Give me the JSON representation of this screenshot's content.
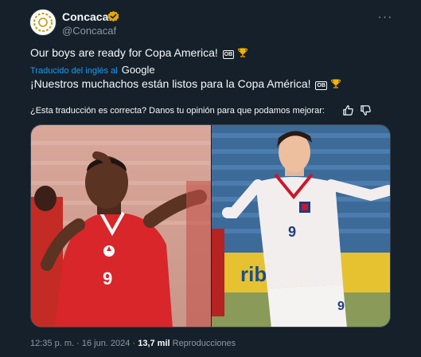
{
  "author": {
    "name": "Concacaf",
    "handle": "@Concacaf",
    "verified_color": "#e8a700"
  },
  "post": {
    "text": "Our boys are ready for Copa America!",
    "badge": "OB",
    "trophy_icon": "trophy-icon"
  },
  "translation": {
    "label": "Traducido del inglés al",
    "provider": "Google",
    "text": "¡Nuestros muchachos están listos para la Copa América!",
    "badge": "OB",
    "feedback": "¿Esta traducción es correcta? Danos tu opinión para que podamos mejorar:"
  },
  "media": {
    "left_photo": "canada-player-number-9",
    "right_photo": "costa-rica-player-number-9",
    "left_jersey_number": "9",
    "right_jersey_number": "9",
    "right_board_text": "rib"
  },
  "meta": {
    "time": "12:35 p. m.",
    "date": "16 jun. 2024",
    "views": "13,7 mil",
    "views_label": "Reproducciones",
    "separator": "·"
  },
  "colors": {
    "background": "#15202b",
    "accent": "#1d9bf0",
    "muted": "#8b98a5"
  }
}
